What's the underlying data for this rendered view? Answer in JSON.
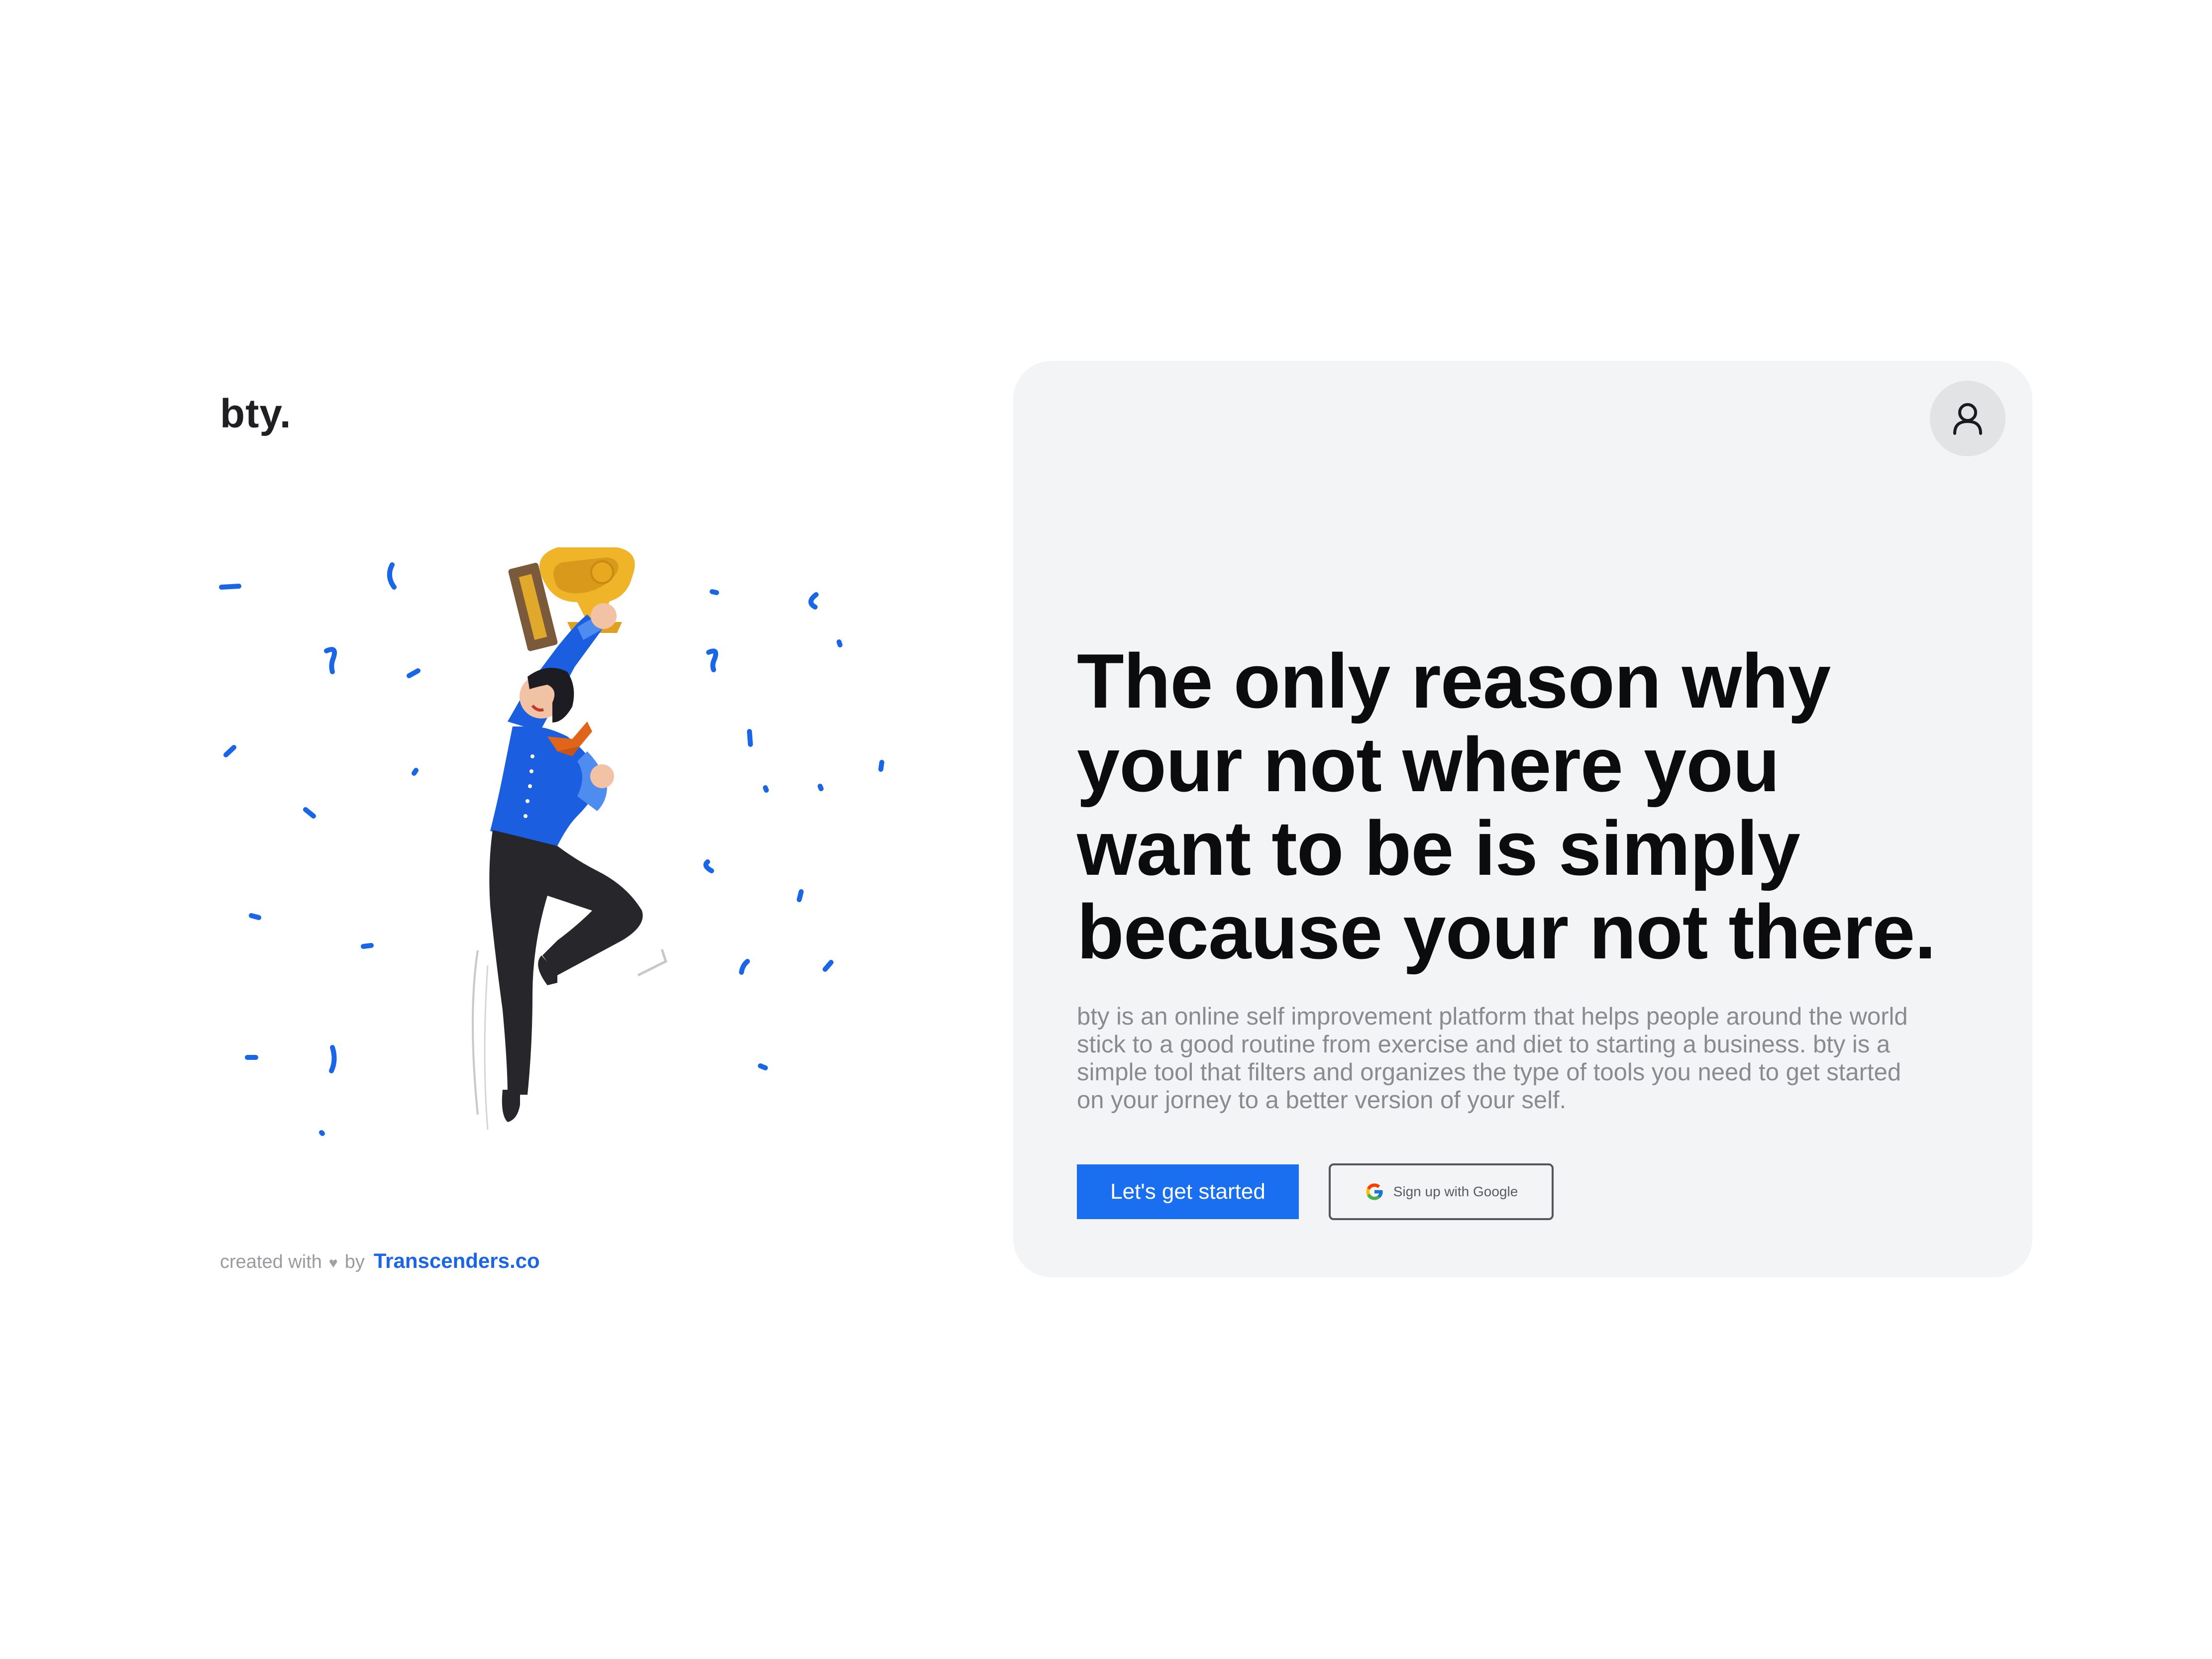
{
  "brand": {
    "logo": "bty."
  },
  "hero": {
    "headline": "The only reason why your not where you want to be is simply because your not there.",
    "description": "bty is an online self improvement platform that helps people around the world stick to a good routine from exercise and diet to starting a business. bty is a simple tool that  filters and organizes the type of tools you need to get started on your jorney to a better version of your self.",
    "primary_cta": "Let's get started",
    "google_cta": "Sign up with Google"
  },
  "footer": {
    "created_with": "created with",
    "by": "by",
    "credit": "Transcenders.co"
  },
  "icons": {
    "account": "user-icon",
    "google": "google-icon",
    "heart": "heart-icon"
  },
  "colors": {
    "accent": "#1a6ff0",
    "card_background": "#f3f4f5",
    "headline": "#0c0c0e",
    "body_text": "#8a8a90"
  }
}
